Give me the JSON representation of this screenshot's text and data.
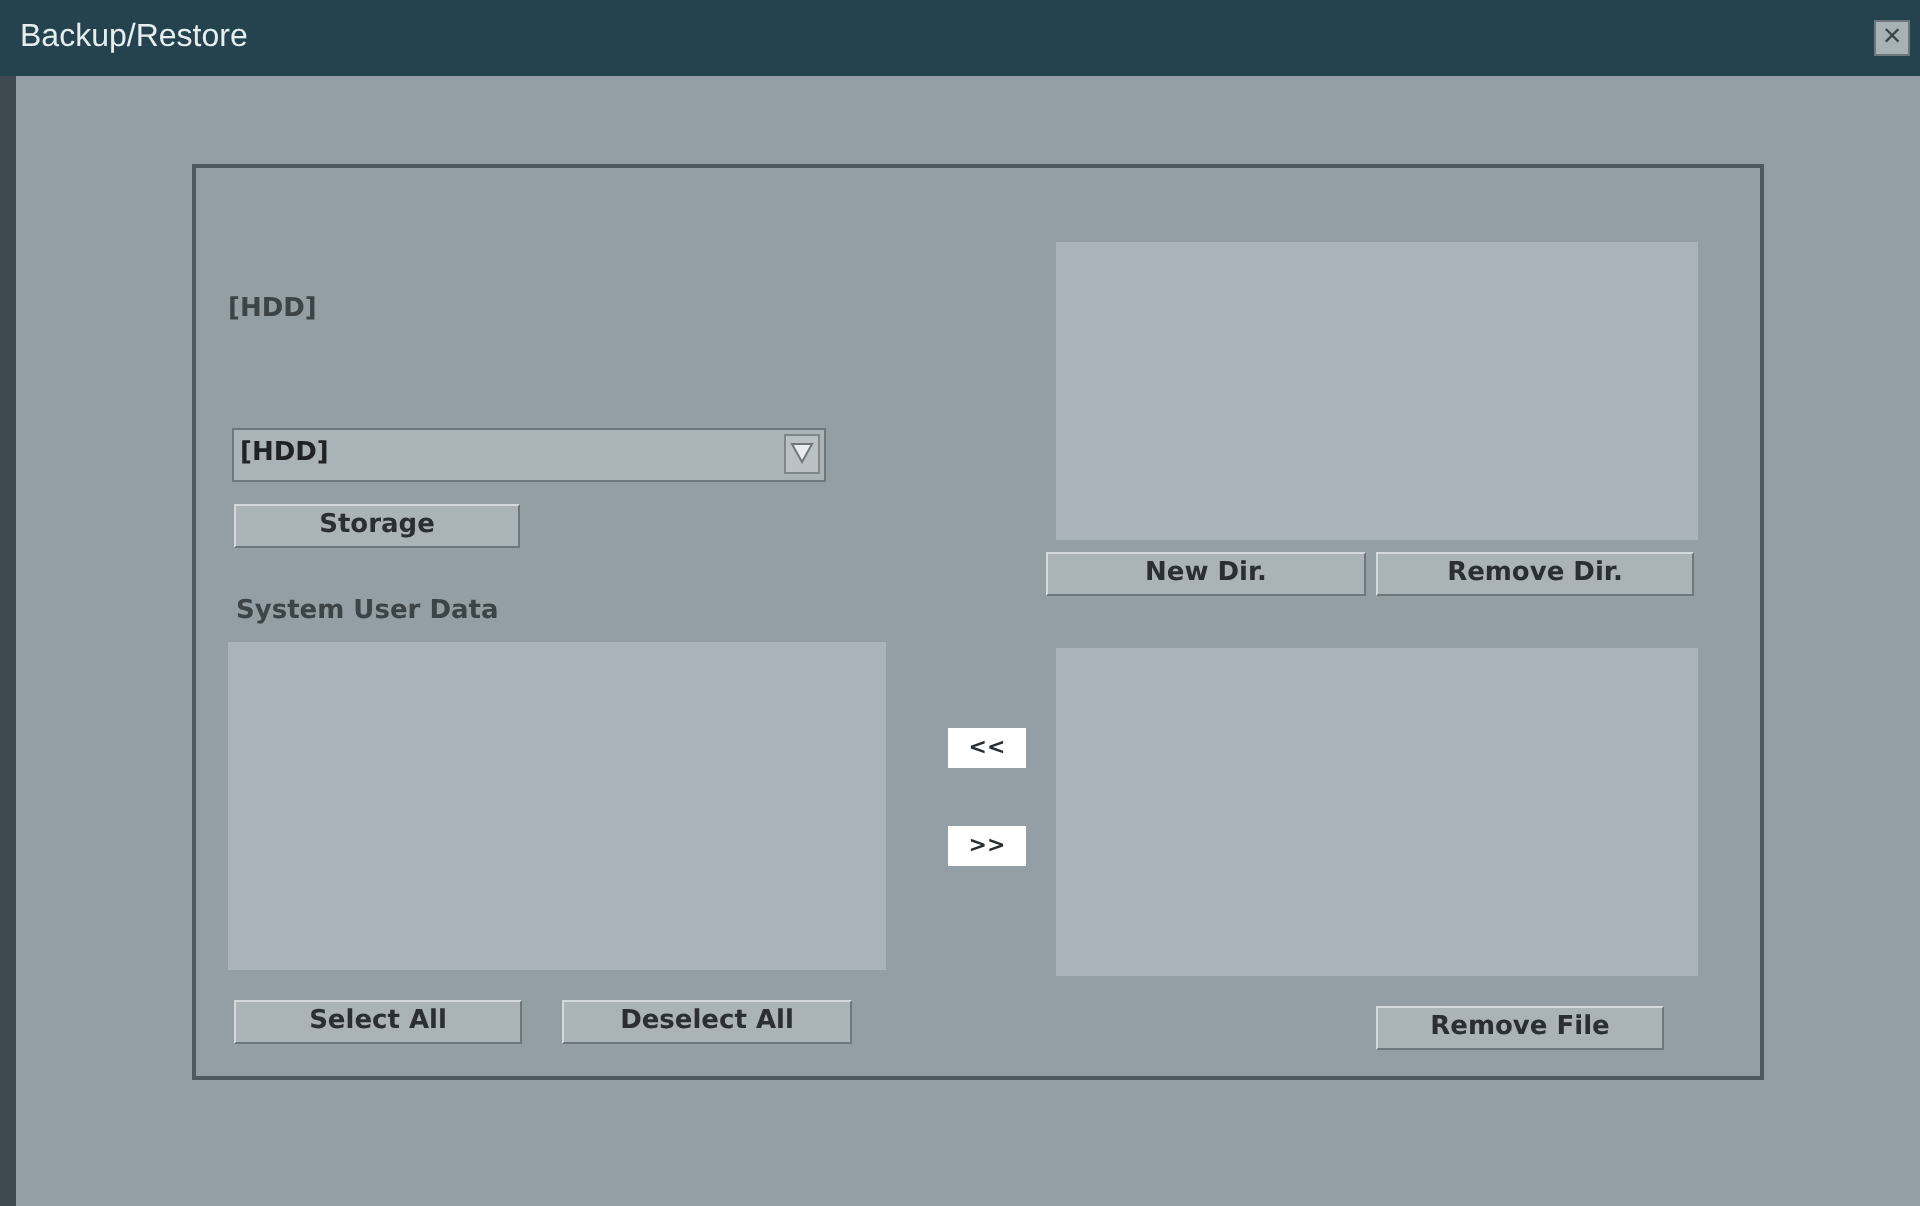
{
  "window": {
    "title": "Backup/Restore",
    "close": "×"
  },
  "source": {
    "label": "[HDD]",
    "dropdown_value": "[HDD]",
    "storage_button": "Storage",
    "list_label": "System User Data",
    "select_all": "Select All",
    "deselect_all": "Deselect All"
  },
  "transfer": {
    "left_button": "<<",
    "right_button": ">>"
  },
  "target": {
    "new_dir": "New Dir.",
    "remove_dir": "Remove Dir.",
    "remove_file": "Remove File"
  }
}
